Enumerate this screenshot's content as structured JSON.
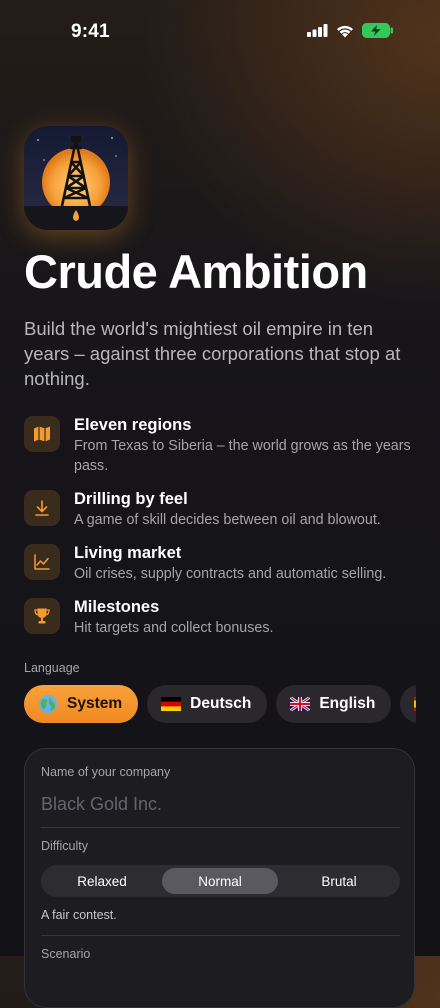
{
  "status_bar": {
    "time": "9:41"
  },
  "app": {
    "title": "Crude Ambition",
    "subtitle": "Build the world's mightiest oil empire in ten years – against three corporations that stop at nothing."
  },
  "features": [
    {
      "icon": "map-icon",
      "title": "Eleven regions",
      "description": "From Texas to Siberia – the world grows as the years pass."
    },
    {
      "icon": "download-arrow-icon",
      "title": "Drilling by feel",
      "description": "A game of skill decides between oil and blowout."
    },
    {
      "icon": "line-chart-icon",
      "title": "Living market",
      "description": "Oil crises, supply contracts and automatic selling."
    },
    {
      "icon": "trophy-icon",
      "title": "Milestones",
      "description": "Hit targets and collect bonuses."
    }
  ],
  "language": {
    "label": "Language",
    "options": [
      {
        "label": "System",
        "icon": "globe-icon",
        "selected": true
      },
      {
        "label": "Deutsch",
        "icon": "german-flag-icon",
        "selected": false
      },
      {
        "label": "English",
        "icon": "uk-flag-icon",
        "selected": false
      },
      {
        "label": "",
        "icon": "spanish-flag-icon",
        "selected": false
      }
    ]
  },
  "form": {
    "company_label": "Name of your company",
    "company_placeholder": "Black Gold Inc.",
    "difficulty_label": "Difficulty",
    "difficulty_options": [
      "Relaxed",
      "Normal",
      "Brutal"
    ],
    "difficulty_selected": "Normal",
    "difficulty_hint": "A fair contest.",
    "scenario_label": "Scenario"
  },
  "colors": {
    "accent": "#f59a30",
    "background": "#141318",
    "card": "#1d1c21"
  }
}
